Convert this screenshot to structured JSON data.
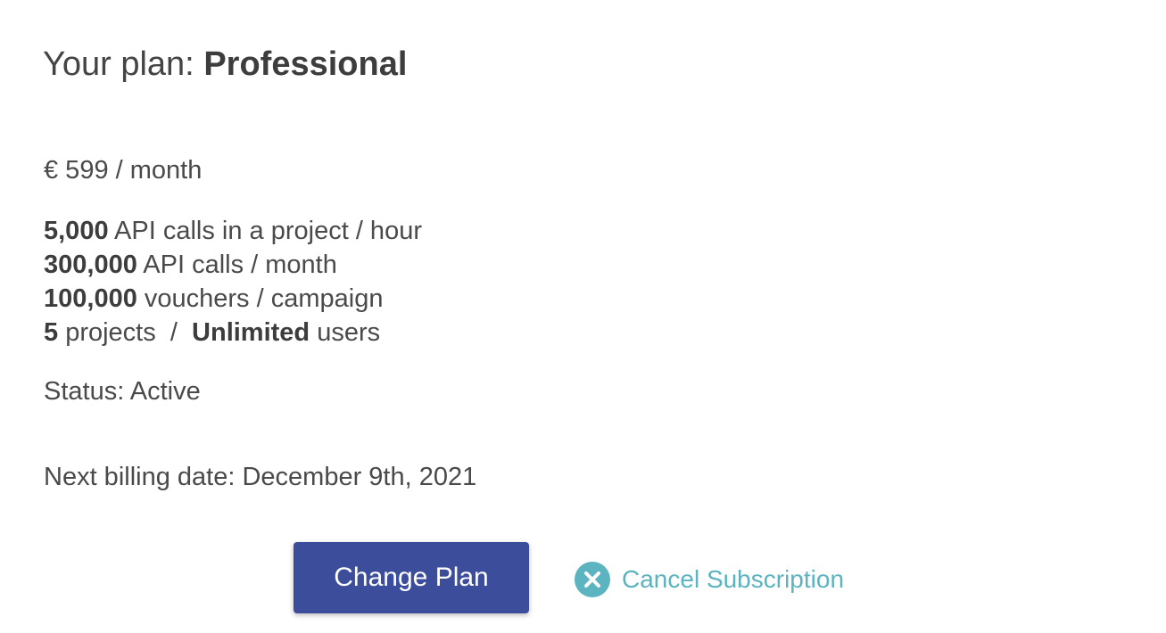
{
  "plan": {
    "label": "Your plan:",
    "name": "Professional"
  },
  "price": "€ 599 / month",
  "limits": [
    {
      "value": "5,000",
      "text": " API calls in a project / hour"
    },
    {
      "value": "300,000",
      "text": " API calls / month"
    },
    {
      "value": "100,000",
      "text": " vouchers / campaign"
    }
  ],
  "limits_last": {
    "projects_value": "5",
    "projects_text": " projects  /  ",
    "users_value": "Unlimited",
    "users_text": " users"
  },
  "status": "Status: Active",
  "billing": "Next billing date: December 9th, 2021",
  "actions": {
    "change_plan_label": "Change Plan",
    "cancel_label": "Cancel Subscription",
    "cancel_icon": "close-circle-icon"
  },
  "colors": {
    "primary_button": "#3b4d9b",
    "cancel_accent": "#5bb4c0",
    "text": "#4a4a4a"
  }
}
